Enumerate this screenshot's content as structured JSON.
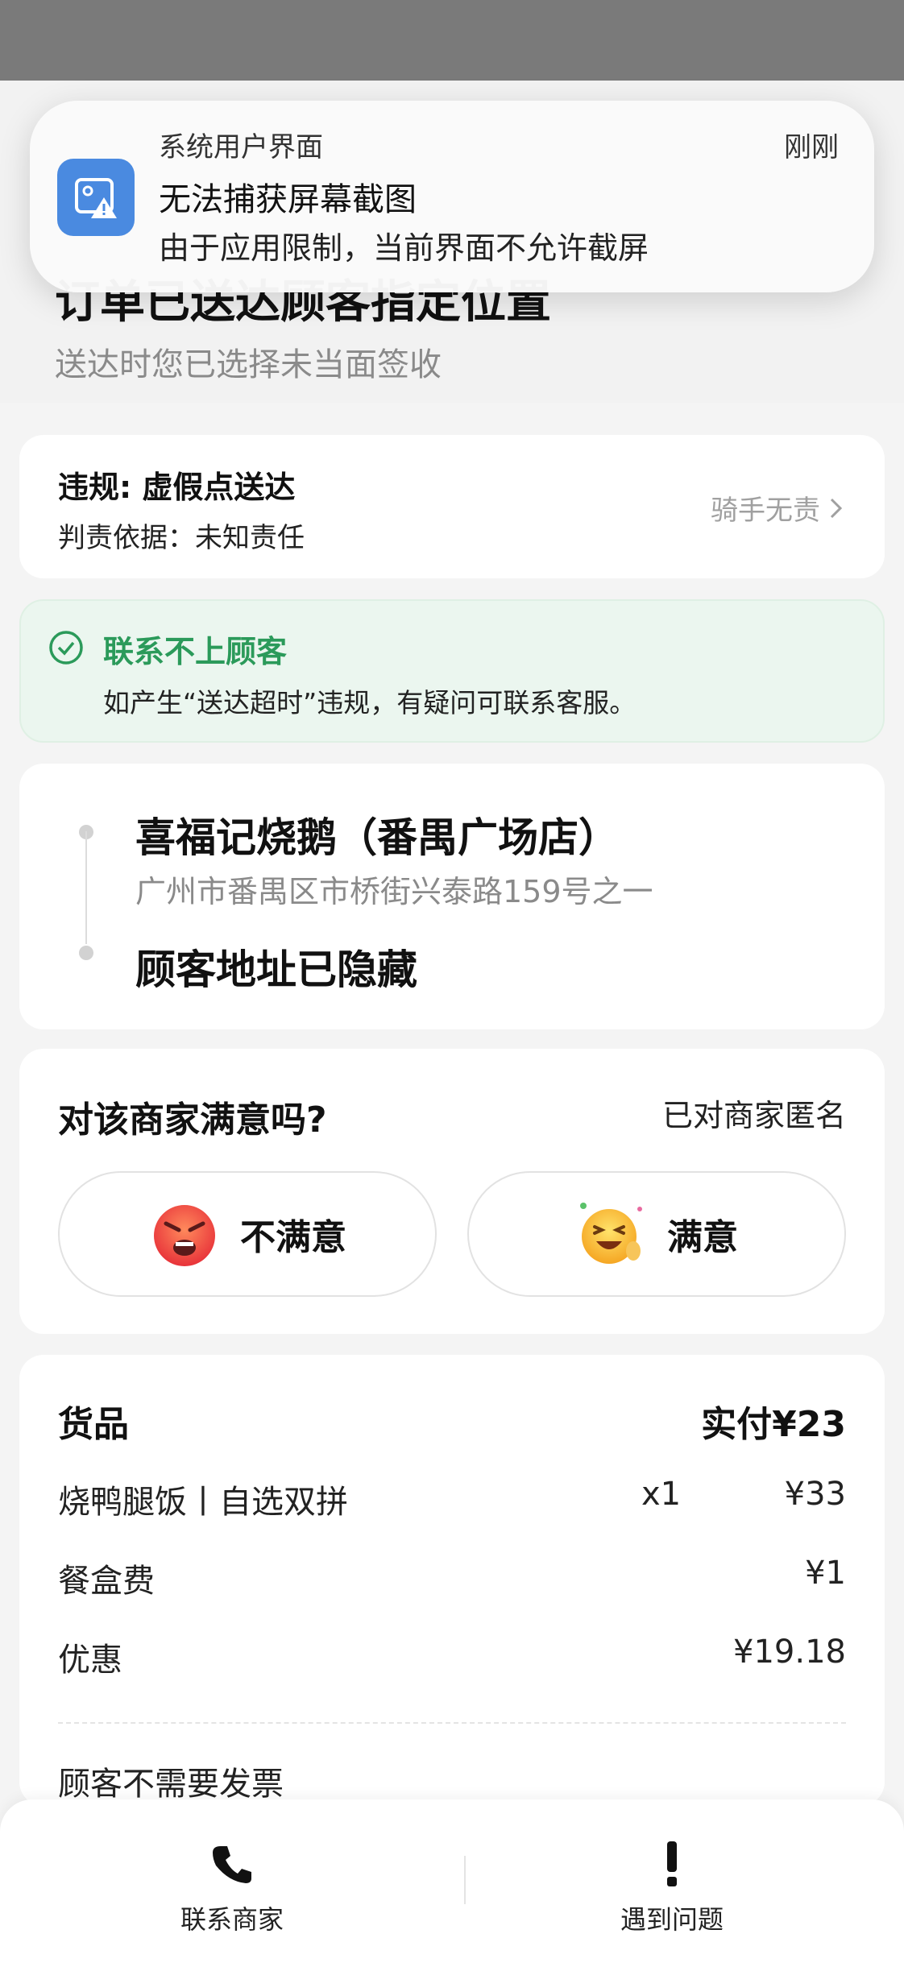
{
  "header": {
    "title": "订单已送达顾客指定位置",
    "subtitle": "送达时您已选择未当面签收"
  },
  "notification": {
    "app": "系统用户界面",
    "time": "刚刚",
    "title": "无法捕获屏幕截图",
    "body": "由于应用限制，当前界面不允许截屏",
    "icon": "screenshot-blocked-icon"
  },
  "violation": {
    "title": "违规: 虚假点送达",
    "basis": "判责依据：未知责任",
    "result": "骑手无责"
  },
  "notice": {
    "title": "联系不上顾客",
    "body": "如产生“送达超时”违规，有疑问可联系客服。",
    "color": "#2b9a5a"
  },
  "address": {
    "shop_name": "喜福记烧鹅（番禺广场店）",
    "shop_address": "广州市番禺区市桥街兴泰路159号之一",
    "customer_address": "顾客地址已隐藏"
  },
  "rating": {
    "question": "对该商家满意吗?",
    "anonymous": "已对商家匿名",
    "bad_label": "不满意",
    "good_label": "满意"
  },
  "goods": {
    "title": "货品",
    "paid": "实付¥23",
    "items": [
      {
        "name": "烧鸭腿饭丨自选双拼",
        "qty": "x1",
        "amount": "¥33"
      },
      {
        "name": "餐盒费",
        "qty": "",
        "amount": "¥1"
      },
      {
        "name": "优惠",
        "qty": "",
        "amount": "¥19.18"
      }
    ],
    "invoice": "顾客不需要发票"
  },
  "bottom_bar": {
    "contact_label": "联系商家",
    "problem_label": "遇到问题"
  }
}
